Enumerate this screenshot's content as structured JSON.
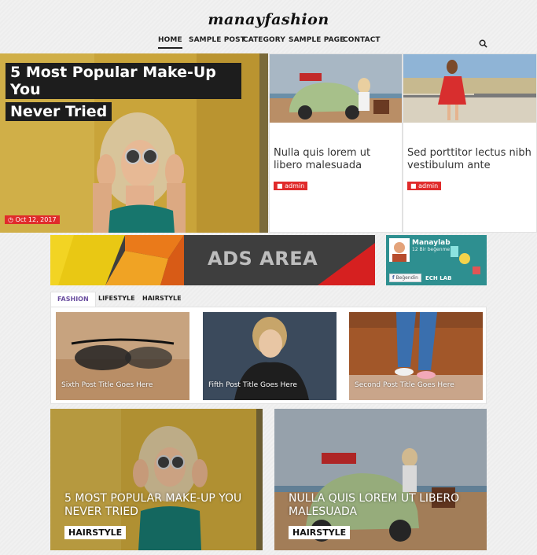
{
  "site": {
    "logo": "manayfashion"
  },
  "nav": {
    "items": [
      {
        "label": "HOME",
        "active": true
      },
      {
        "label": "SAMPLE POST"
      },
      {
        "label": "CATEGORY"
      },
      {
        "label": "SAMPLE PAGE"
      },
      {
        "label": "CONTACT"
      }
    ],
    "search_icon": "search-icon"
  },
  "hero": {
    "main": {
      "title_line1": "5 Most Popular Make-Up You",
      "title_line2": "Never Tried",
      "date": "Oct 12, 2017",
      "date_icon": "clock-icon"
    },
    "cards": [
      {
        "title": "Nulla quis lorem ut libero malesuada",
        "author": "admin",
        "author_icon": "user-icon"
      },
      {
        "title": "Sed porttitor lectus nibh vestibulum ante",
        "author": "admin",
        "author_icon": "user-icon"
      }
    ]
  },
  "ads": {
    "label": "ADS AREA"
  },
  "fb_widget": {
    "name": "Manaylab",
    "likes": "12 Bir beğenme",
    "like_button": "Beğendin",
    "footer": "ECH LAB"
  },
  "tabs": {
    "items": [
      {
        "label": "FASHION",
        "active": true
      },
      {
        "label": "LIFESTYLE"
      },
      {
        "label": "HAIRSTYLE"
      }
    ],
    "posts": [
      {
        "title": "Sixth Post Title Goes Here"
      },
      {
        "title": "Fifth Post Title Goes Here"
      },
      {
        "title": "Second Post Title Goes Here"
      }
    ]
  },
  "bottom_posts": [
    {
      "title": "5 MOST POPULAR MAKE-UP YOU NEVER TRIED",
      "category": "HAIRSTYLE"
    },
    {
      "title": "NULLA QUIS LOREM UT LIBERO MALESUADA",
      "category": "HAIRSTYLE"
    }
  ],
  "colors": {
    "accent_red": "#e02b2b",
    "tab_active": "#6b4fa0",
    "dark": "#1d1d1d"
  }
}
